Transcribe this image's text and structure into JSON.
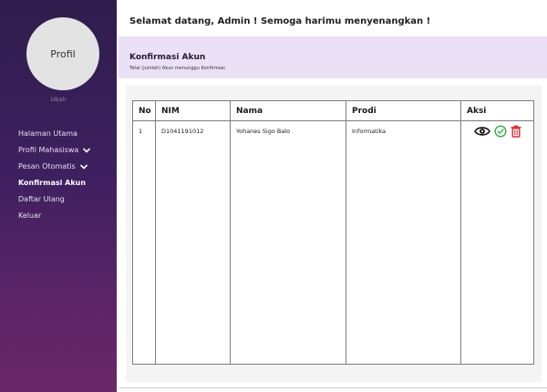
{
  "sidebar": {
    "avatar_label": "Profil",
    "edit_link": "Ubah",
    "items": [
      {
        "label": "Halaman Utama"
      },
      {
        "label": "Profil Mahasiswa"
      },
      {
        "label": "Pesan Otomatis"
      },
      {
        "label": "Konfirmasi Akun"
      },
      {
        "label": "Daftar Ulang"
      },
      {
        "label": "Keluar"
      }
    ],
    "active_item": "Konfirmasi Akun"
  },
  "header": {
    "greeting": "Selamat datang, Admin ! Semoga harimu menyenangkan !",
    "title": "Konfirmasi Akun",
    "subtitle": "Total (jumlah) Akun menunggu Konfirmasi"
  },
  "table": {
    "columns": [
      "No",
      "NIM",
      "Nama",
      "Prodi",
      "Aksi"
    ],
    "rows": [
      {
        "no": "1",
        "nim": "D1041191012",
        "nama": "Yohanes Sigo Balo",
        "prodi": "Informatika"
      }
    ]
  },
  "icons": {
    "view": "eye-icon",
    "approve": "check-circle-icon",
    "delete": "trash-icon"
  },
  "colors": {
    "sidebar_top": "#2e1d4c",
    "sidebar_bottom": "#6a2868",
    "header_band": "#ebe1f6",
    "approve": "#2fb24a",
    "delete": "#e0262b"
  }
}
